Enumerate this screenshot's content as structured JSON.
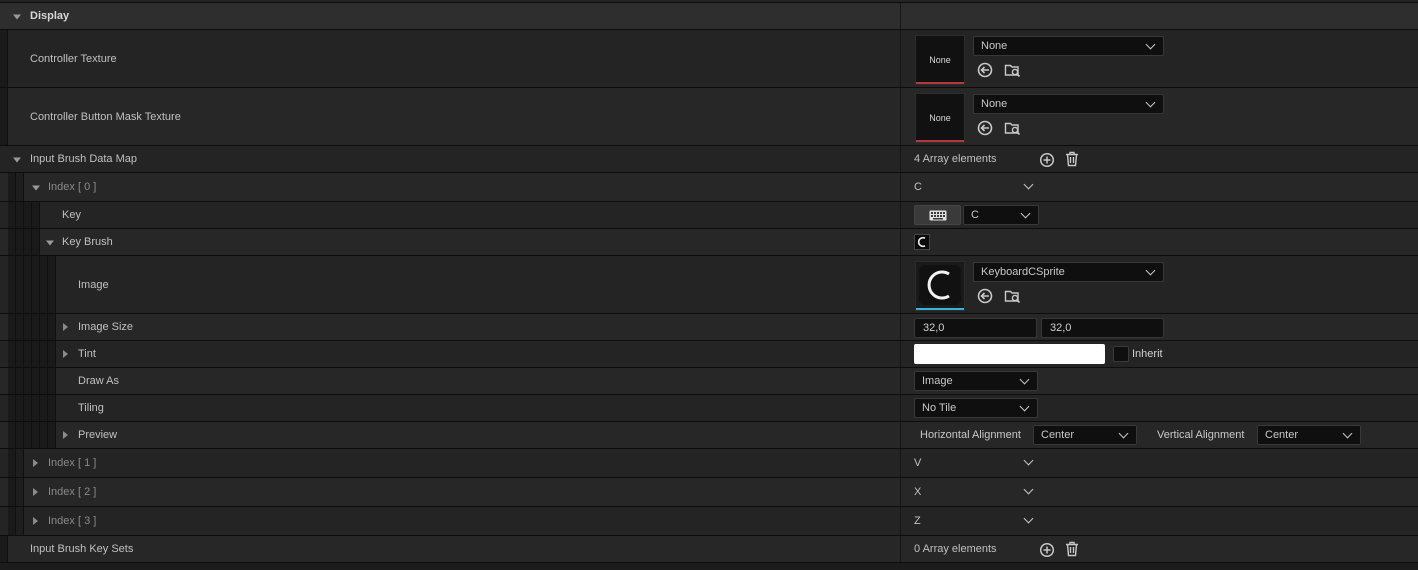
{
  "display": {
    "category_label": "Display",
    "controller_texture": {
      "label": "Controller Texture",
      "asset": "None",
      "thumb_text": "None"
    },
    "controller_button_mask": {
      "label": "Controller Button Mask Texture",
      "asset": "None",
      "thumb_text": "None"
    },
    "input_brush_data_map": {
      "label": "Input Brush Data Map",
      "count_text": "4 Array elements",
      "indices": [
        {
          "label": "Index [ 0 ]",
          "value": "C"
        },
        {
          "label": "Index [ 1 ]",
          "value": "V"
        },
        {
          "label": "Index [ 2 ]",
          "value": "X"
        },
        {
          "label": "Index [ 3 ]",
          "value": "Z"
        }
      ],
      "key": {
        "label": "Key",
        "value": "C"
      },
      "key_brush": {
        "label": "Key Brush",
        "image": {
          "label": "Image",
          "asset": "KeyboardCSprite"
        },
        "image_size": {
          "label": "Image Size",
          "x": "32,0",
          "y": "32,0"
        },
        "tint": {
          "label": "Tint",
          "inherit_label": "Inherit",
          "color": "#ffffff"
        },
        "draw_as": {
          "label": "Draw As",
          "value": "Image"
        },
        "tiling": {
          "label": "Tiling",
          "value": "No Tile"
        },
        "preview": {
          "label": "Preview",
          "h_align_label": "Horizontal Alignment",
          "h_align_value": "Center",
          "v_align_label": "Vertical Alignment",
          "v_align_value": "Center"
        }
      }
    },
    "input_brush_key_sets": {
      "label": "Input Brush Key Sets",
      "count_text": "0 Array elements"
    }
  },
  "colors": {
    "none_thumb_bar": "#b8343f",
    "sprite_thumb_bar": "#35b7d8",
    "accent": "#c0c0c0"
  }
}
